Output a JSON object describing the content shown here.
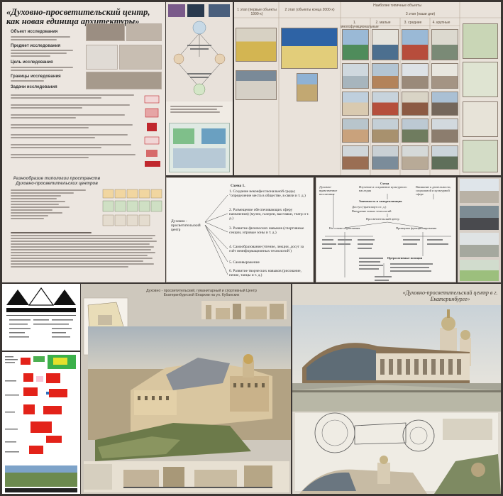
{
  "title": "«Духовно-просветительский центр, как новая единица архитектуры»",
  "p1_sections": [
    "Объект исследования",
    "Предмет исследования",
    "Цель исследования",
    "Границы исследования",
    "Задачи исследования"
  ],
  "p1_sub_heading": "Разнообразие типологии  пространств Духовно-просветительских центров",
  "scheme1": {
    "heading": "Схема 1.",
    "center_label": "Духовно - просветительский центр",
    "items": [
      "1. Создание неконфессиональной среды; \"определение места в обществе, в связи и т. д.)",
      "2. Размещение обеспечивающих сферу  назначения) (музеи, галереи, выставки, театр и т. д.)",
      "3. Развитие физических навыков (спортивные секции, игровые зоны и т. д.)",
      "4. Самообразование (чтение, лекции, досуг за счёт неинформационных технологий )",
      "5. Самовыражение",
      "6. Развитие творческих навыков (рисование, пение, танцы и т. д.)"
    ]
  },
  "scheme2": {
    "heading": "Схема",
    "nodes": [
      "Духовно-нравственное воспитание",
      "Изучение и сохранение культурного наследия",
      "Внимание к деятельности, социальной и культурной сфере",
      "Значимость и самореализация",
      "Доступ (транспорт и т. д.)",
      "Внедрение новых технологий",
      "Просветительский центр",
      "На основе образования",
      "Принципы функционирования",
      "Прерогативные позиции"
    ]
  },
  "boardA_caption": "Духовно - просветительский, гуманитарный и спортивный Центр Екатеринбургской Епархии на ул. Кубанских",
  "boardB_caption": "«Духовно-просветительский центр в г. Екатеринбурге»",
  "p3_headers": [
    "1 этап (первые объекты 1990-х)",
    "2 этап (объекты конца 2000-х)",
    "Наиболее типичные объекты",
    "3 этап (наши дни)",
    "1. многофункциональные",
    "2. малые",
    "3. средние",
    "4. крупные"
  ],
  "colors": {
    "board_bg": "#ece6e0",
    "background": "#3a3532",
    "sky": "#d9d3c4",
    "accent_red": "#c0272d"
  }
}
